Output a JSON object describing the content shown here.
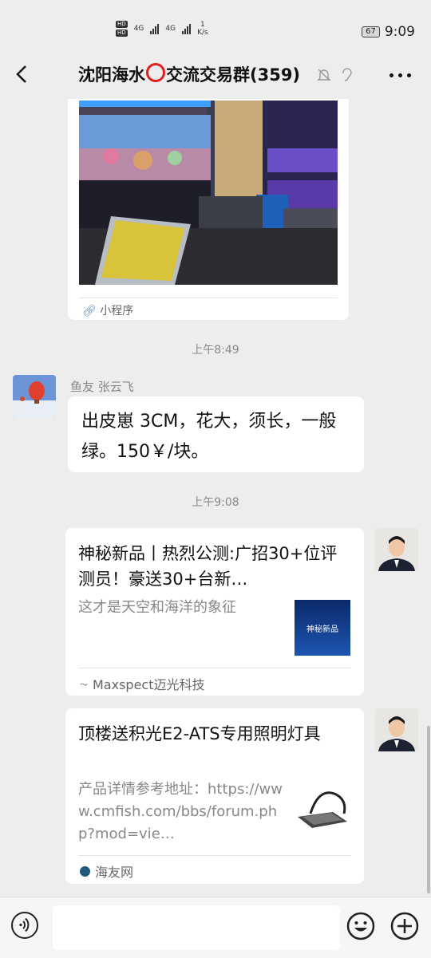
{
  "status_bar": {
    "hd1": "HD",
    "hd2": "HD",
    "net1": "4G",
    "net2": "4G",
    "speed_value": "1",
    "speed_unit": "K/s",
    "battery": "67",
    "time": "9:09"
  },
  "header": {
    "title_before": "沈阳海水",
    "title_after": "交流交易群(359)"
  },
  "messages": {
    "mini_program_label": "小程序",
    "time1": "上午8:49",
    "sender_name": "鱼友 张云飞",
    "text_message": "出皮崽 3CM，花大，须长，一般绿。150￥/块。",
    "time2": "上午9:08",
    "card1": {
      "title": "神秘新品丨热烈公测:广招30+位评测员！豪送30+台新…",
      "desc": "这才是天空和海洋的象征",
      "thumb_text": "神秘新品",
      "source": "Maxspect迈光科技"
    },
    "card2": {
      "title": "顶楼送积光E2-ATS专用照明灯具",
      "desc": "产品详情参考地址：https://www.cmfish.com/bbs/forum.php?mod=vie…",
      "source": "海友网"
    }
  },
  "colors": {
    "background": "#ededed",
    "bubble": "#ffffff",
    "title_ring": "#e02020"
  }
}
